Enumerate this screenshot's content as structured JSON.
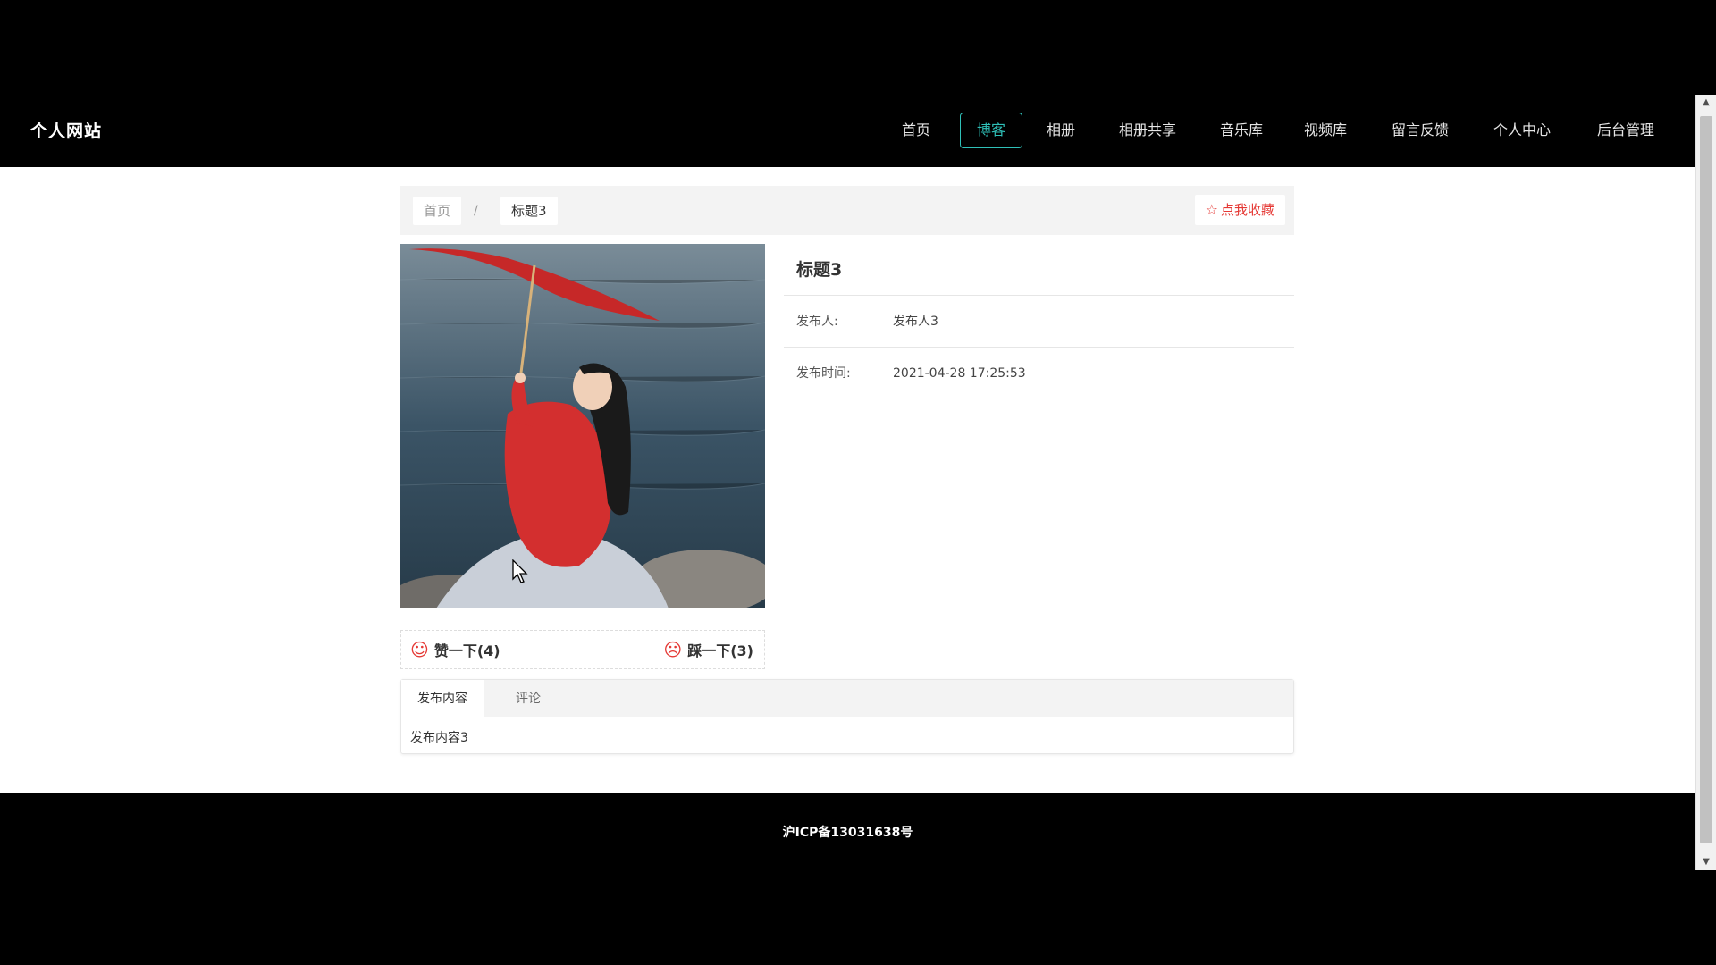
{
  "header": {
    "brand": "个人网站",
    "nav": [
      {
        "label": "首页",
        "active": false
      },
      {
        "label": "博客",
        "active": true
      },
      {
        "label": "相册",
        "active": false
      },
      {
        "label": "相册共享",
        "active": false
      },
      {
        "label": "音乐库",
        "active": false
      },
      {
        "label": "视频库",
        "active": false
      },
      {
        "label": "留言反馈",
        "active": false
      },
      {
        "label": "个人中心",
        "active": false
      },
      {
        "label": "后台管理",
        "active": false
      }
    ]
  },
  "breadcrumb": {
    "home": "首页",
    "separator": "/",
    "current": "标题3"
  },
  "favorite": {
    "icon": "star-outline-icon",
    "label": "点我收藏"
  },
  "post": {
    "title": "标题3",
    "publisher_label": "发布人:",
    "publisher": "发布人3",
    "time_label": "发布时间:",
    "time": "2021-04-28 17:25:53",
    "image_alt": "hanfu-umbrella-photo"
  },
  "votes": {
    "like_label": "赞一下(4)",
    "dislike_label": "踩一下(3)",
    "like_icon": "smile-icon",
    "dislike_icon": "frown-icon"
  },
  "tabs": {
    "items": [
      {
        "label": "发布内容",
        "active": true
      },
      {
        "label": "评论",
        "active": false
      }
    ],
    "content": "发布内容3"
  },
  "footer": {
    "icp": "沪ICP备13031638号"
  },
  "colors": {
    "accent": "#2fc0b8",
    "favorite": "#e53935",
    "header_bg": "#000000"
  }
}
